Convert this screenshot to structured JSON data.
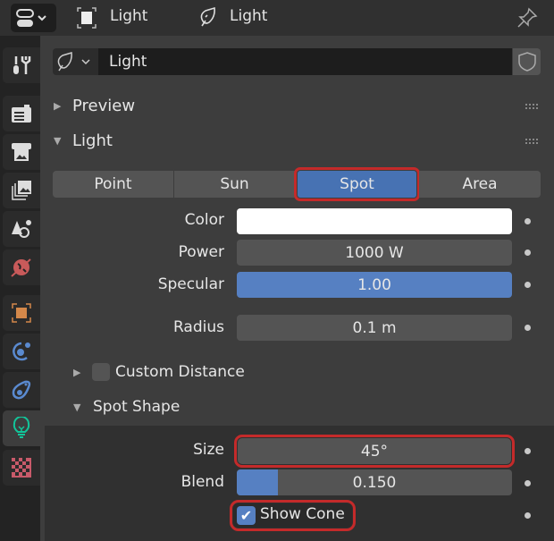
{
  "header": {
    "editor_type_icon": "properties-editor-icon",
    "breadcrumb": [
      {
        "icon": "object-data-icon",
        "label": "Light"
      },
      {
        "icon": "light-data-icon",
        "label": "Light"
      }
    ],
    "pin_icon": "pin-icon"
  },
  "sidebar": {
    "tabs": [
      "tool",
      "render",
      "output",
      "view-layer",
      "scene",
      "world",
      "object",
      "physics",
      "constraints",
      "light-data",
      "texture"
    ],
    "active": "light-data"
  },
  "datablock": {
    "name": "Light",
    "fake_user_icon": "shield-icon"
  },
  "panels": {
    "preview": "Preview",
    "light": "Light"
  },
  "light_types": [
    "Point",
    "Sun",
    "Spot",
    "Area"
  ],
  "selected_type": "Spot",
  "props": {
    "color_label": "Color",
    "color_value": "#ffffff",
    "power_label": "Power",
    "power_value": "1000 W",
    "specular_label": "Specular",
    "specular_value": "1.00",
    "specular_fill": 1.0,
    "radius_label": "Radius",
    "radius_value": "0.1 m"
  },
  "custom_distance": {
    "label": "Custom Distance",
    "checked": false
  },
  "spot_shape": {
    "title": "Spot Shape",
    "size_label": "Size",
    "size_value": "45°",
    "blend_label": "Blend",
    "blend_value": "0.150",
    "blend_fill": 0.15,
    "show_cone_label": "Show Cone",
    "show_cone_checked": true
  },
  "colors": {
    "accent": "#5680c2",
    "highlight": "#c42a2a",
    "light_tab": "#12c59a"
  }
}
